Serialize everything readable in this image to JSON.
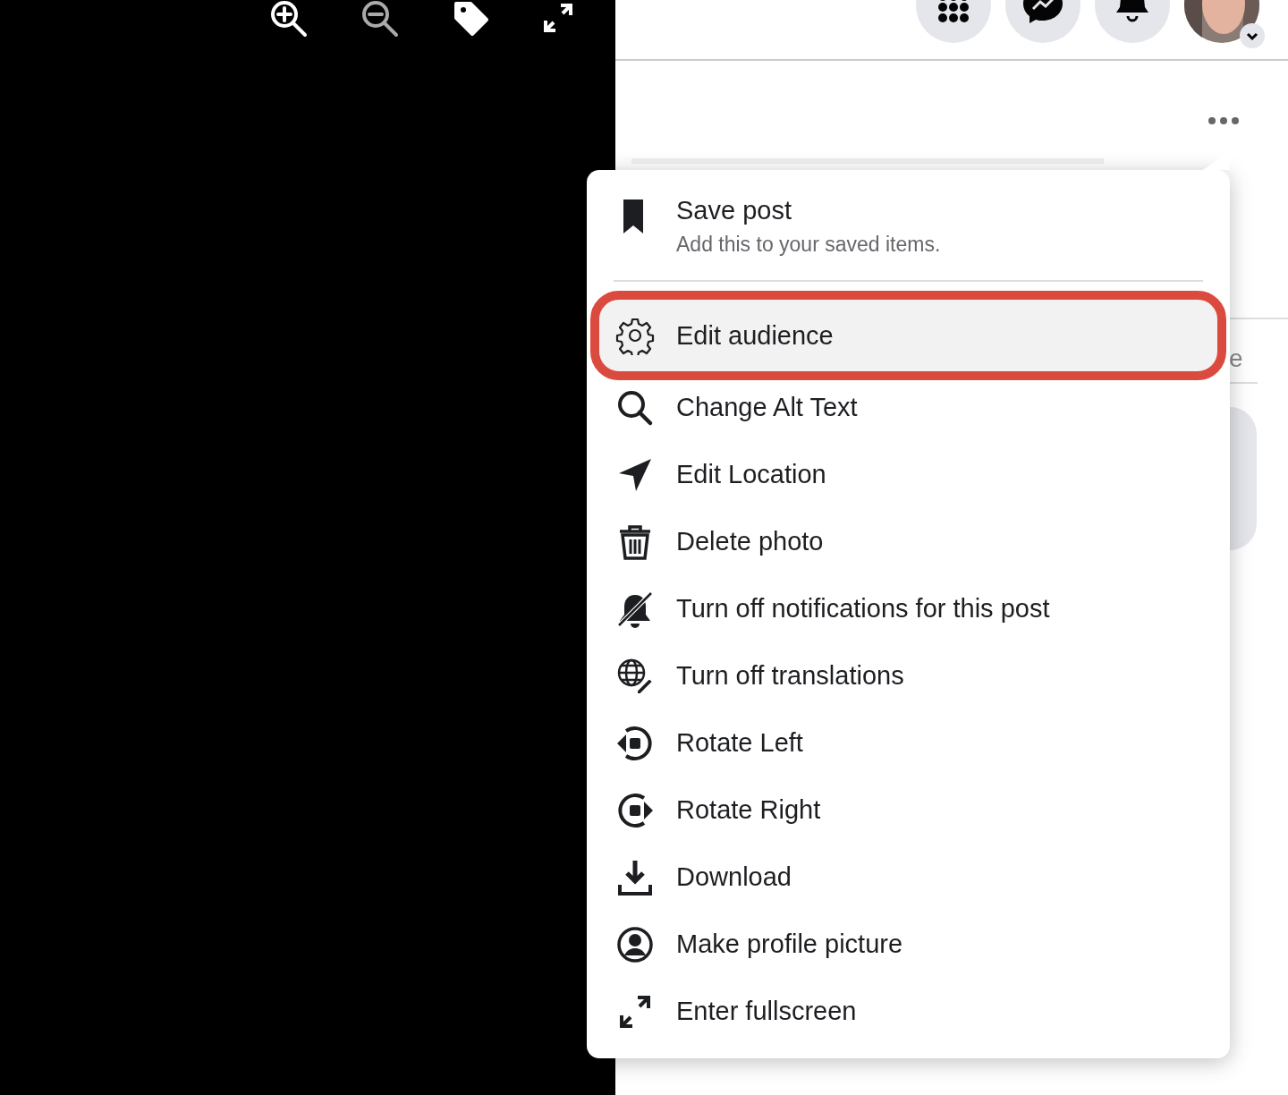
{
  "background_text": "e",
  "menu": {
    "items": [
      {
        "label": "Save post",
        "description": "Add this to your saved items.",
        "highlighted": false
      },
      {
        "label": "Edit audience",
        "highlighted": true
      },
      {
        "label": "Change Alt Text",
        "highlighted": false
      },
      {
        "label": "Edit Location",
        "highlighted": false
      },
      {
        "label": "Delete photo",
        "highlighted": false
      },
      {
        "label": "Turn off notifications for this post",
        "highlighted": false
      },
      {
        "label": "Turn off translations",
        "highlighted": false
      },
      {
        "label": "Rotate Left",
        "highlighted": false
      },
      {
        "label": "Rotate Right",
        "highlighted": false
      },
      {
        "label": "Download",
        "highlighted": false
      },
      {
        "label": "Make profile picture",
        "highlighted": false
      },
      {
        "label": "Enter fullscreen",
        "highlighted": false
      }
    ]
  }
}
